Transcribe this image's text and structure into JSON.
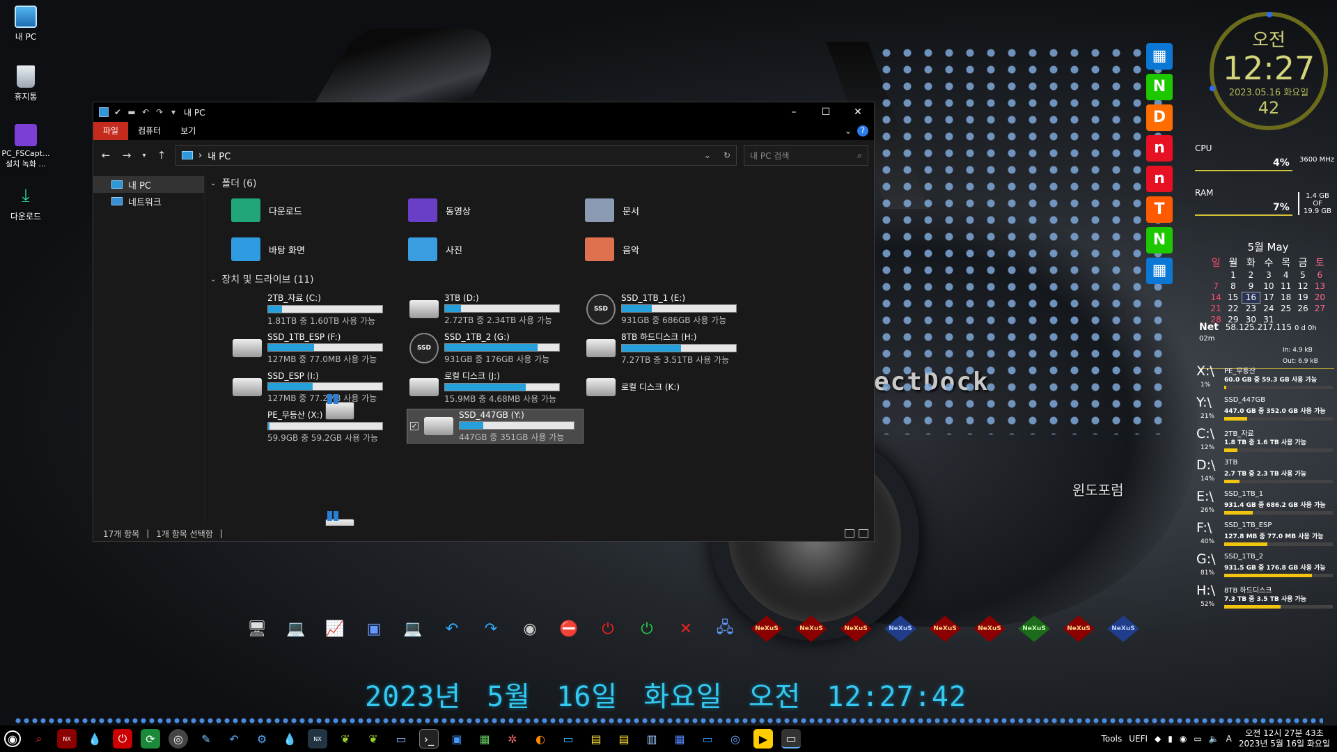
{
  "desktop": {
    "icons": [
      {
        "label": "내 PC"
      },
      {
        "label": "휴지통"
      },
      {
        "label": "PC_FSCapt... 설치 녹화 ..."
      },
      {
        "label": "다운로드"
      }
    ],
    "dock_text": "ectDock",
    "watermark": "윈도포럼"
  },
  "explorer": {
    "title": "내 PC",
    "ribbon_tabs": [
      "파일",
      "컴퓨터",
      "보기"
    ],
    "address": "내 PC",
    "search_placeholder": "내 PC 검색",
    "sidebar": [
      "내 PC",
      "네트워크"
    ],
    "folders_header": "폴더 (6)",
    "folders": [
      {
        "name": "다운로드",
        "color": "#21a67a"
      },
      {
        "name": "동영상",
        "color": "#6a3fc8"
      },
      {
        "name": "문서",
        "color": "#8a9bb3"
      },
      {
        "name": "바탕 화면",
        "color": "#2f9be0"
      },
      {
        "name": "사진",
        "color": "#3a9de0"
      },
      {
        "name": "음악",
        "color": "#e0714f"
      }
    ],
    "drives_header": "장치 및 드라이브 (11)",
    "drives": [
      {
        "name": "2TB_자료 (C:)",
        "free": "1.81TB 중 1.60TB 사용 가능",
        "used": 0.12,
        "type": "win"
      },
      {
        "name": "3TB (D:)",
        "free": "2.72TB 중 2.34TB 사용 가능",
        "used": 0.14,
        "type": "hdd"
      },
      {
        "name": "SSD_1TB_1 (E:)",
        "free": "931GB 중 686GB 사용 가능",
        "used": 0.26,
        "type": "ssd"
      },
      {
        "name": "SSD_1TB_ESP (F:)",
        "free": "127MB 중 77.0MB 사용 가능",
        "used": 0.4,
        "type": "hdd"
      },
      {
        "name": "SSD_1TB_2 (G:)",
        "free": "931GB 중 176GB 사용 가능",
        "used": 0.81,
        "type": "ssd"
      },
      {
        "name": "8TB 하드디스크 (H:)",
        "free": "7.27TB 중 3.51TB 사용 가능",
        "used": 0.52,
        "type": "hdd"
      },
      {
        "name": "SSD_ESP (I:)",
        "free": "127MB 중 77.2MB 사용 가능",
        "used": 0.39,
        "type": "hdd"
      },
      {
        "name": "로컬 디스크 (J:)",
        "free": "15.9MB 중 4.68MB 사용 가능",
        "used": 0.71,
        "type": "hdd"
      },
      {
        "name": "로컬 디스크 (K:)",
        "free": "",
        "used": null,
        "type": "hdd"
      },
      {
        "name": "PE_무등산 (X:)",
        "free": "59.9GB 중 59.2GB 사용 가능",
        "used": 0.01,
        "type": "win"
      },
      {
        "name": "SSD_447GB (Y:)",
        "free": "447GB 중 351GB 사용 가능",
        "used": 0.21,
        "type": "hdd",
        "selected": true
      }
    ],
    "status_count": "17개 항목",
    "status_selected": "1개 항목 선택함"
  },
  "clock": {
    "ampm": "오전",
    "time": "12:27",
    "date": "2023.05.16 화요일",
    "seconds": "42"
  },
  "cpu": {
    "label": "CPU",
    "pct": "4%",
    "freq": "3600 MHz"
  },
  "ram": {
    "label": "RAM",
    "pct": "7%",
    "used": "1.4 GB",
    "of": "OF",
    "total": "19.9 GB"
  },
  "calendar": {
    "title": "5월 May",
    "weekdays": [
      "일",
      "월",
      "화",
      "수",
      "목",
      "금",
      "토"
    ],
    "weeks": [
      [
        "",
        "1",
        "2",
        "3",
        "4",
        "5",
        "6"
      ],
      [
        "7",
        "8",
        "9",
        "10",
        "11",
        "12",
        "13"
      ],
      [
        "14",
        "15",
        "16",
        "17",
        "18",
        "19",
        "20"
      ],
      [
        "21",
        "22",
        "23",
        "24",
        "25",
        "26",
        "27"
      ],
      [
        "28",
        "29",
        "30",
        "31",
        "",
        "",
        ""
      ]
    ]
  },
  "net": {
    "label": "Net",
    "ip": "58.125.217.115",
    "uptime": "0 d 0h 02m",
    "in": "In: 4.9 kB",
    "out": "Out: 6.9 kB"
  },
  "drive_meters": [
    {
      "letter": "X:\\",
      "pct": "1%",
      "name": "PE_무등산",
      "nums": "60.0 GB 중   59.3 GB 사용 가능",
      "fill": 0.01
    },
    {
      "letter": "Y:\\",
      "pct": "21%",
      "name": "SSD_447GB",
      "nums": "447.0 GB 중  352.0 GB 사용 가능",
      "fill": 0.21
    },
    {
      "letter": "C:\\",
      "pct": "12%",
      "name": "2TB_자료",
      "nums": "1.8 TB 중    1.6 TB 사용 가능",
      "fill": 0.12
    },
    {
      "letter": "D:\\",
      "pct": "14%",
      "name": "3TB",
      "nums": "2.7 TB 중    2.3 TB 사용 가능",
      "fill": 0.14
    },
    {
      "letter": "E:\\",
      "pct": "26%",
      "name": "SSD_1TB_1",
      "nums": "931.4 GB 중  686.2 GB 사용 가능",
      "fill": 0.26
    },
    {
      "letter": "F:\\",
      "pct": "40%",
      "name": "SSD_1TB_ESP",
      "nums": "127.8 MB 중  77.0 MB 사용 가능",
      "fill": 0.4
    },
    {
      "letter": "G:\\",
      "pct": "81%",
      "name": "SSD_1TB_2",
      "nums": "931.5 GB 중  176.8 GB 사용 가능",
      "fill": 0.81
    },
    {
      "letter": "H:\\",
      "pct": "52%",
      "name": "8TB 하드디스크",
      "nums": "7.3 TB 중    3.5 TB 사용 가능",
      "fill": 0.52
    }
  ],
  "tiles": [
    {
      "icon": "windows-icon",
      "glyph": "▦",
      "color": "#0a78d4"
    },
    {
      "icon": "naver-icon",
      "glyph": "N",
      "color": "#1ec800"
    },
    {
      "icon": "daum-icon",
      "glyph": "D",
      "color": "#ff6d00"
    },
    {
      "icon": "n-icon",
      "glyph": "n",
      "color": "#e81123"
    },
    {
      "icon": "n2-icon",
      "glyph": "n",
      "color": "#e81123"
    },
    {
      "icon": "t2-icon",
      "glyph": "T",
      "color": "#ff5a00"
    },
    {
      "icon": "naver2-icon",
      "glyph": "N",
      "color": "#1ec800"
    },
    {
      "icon": "windows2-icon",
      "glyph": "▦",
      "color": "#0a78d4"
    }
  ],
  "dock": [
    {
      "icon": "monitor-icon",
      "glyph": "🖥"
    },
    {
      "icon": "network-pc-icon",
      "glyph": "💻"
    },
    {
      "icon": "performance-icon",
      "glyph": "📈"
    },
    {
      "icon": "virtualbox-icon",
      "glyph": "▣"
    },
    {
      "icon": "laptop-icon",
      "glyph": "💻"
    },
    {
      "icon": "undo-icon",
      "glyph": "↶"
    },
    {
      "icon": "redo-icon",
      "glyph": "↷"
    },
    {
      "icon": "speaker-icon",
      "glyph": "◉"
    },
    {
      "icon": "disconnect-icon",
      "glyph": "⛔"
    },
    {
      "icon": "power-icon",
      "glyph": "⏻"
    },
    {
      "icon": "power-green-icon",
      "glyph": "⏻"
    },
    {
      "icon": "close-x-icon",
      "glyph": "✕"
    },
    {
      "icon": "remote-desktop-icon",
      "glyph": "🖧"
    }
  ],
  "nexus_label": "NeXuS",
  "big_date": "2023년 5월 16일 화요일 오전 12:27:42",
  "taskbar": {
    "tools_label": "Tools",
    "uefi_label": "UEFI",
    "lang": "A",
    "time_line": "오전 12시 27분 43초",
    "date_line": "2023년 5월 16일 화요일"
  }
}
